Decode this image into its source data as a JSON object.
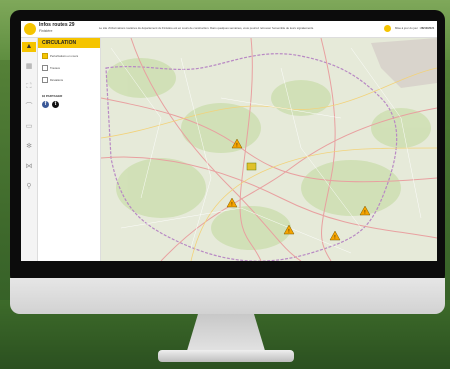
{
  "app": {
    "title": "Infos routes 29",
    "subtitle": "Finistère",
    "notice": "Le site d'informations routières du département du Finistère est en cours de construction. Dans quelques semaines, vous pourrez retrouver l'ensemble de leurs signalements.",
    "date_label": "Mise à jour du jour :",
    "date_value": "28/10/2021"
  },
  "rail": {
    "icons": [
      "circulation-icon",
      "calendar-icon",
      "road-icon",
      "bridge-icon",
      "truck-icon",
      "snow-icon",
      "share-rail-icon",
      "search-rail-icon"
    ]
  },
  "panel": {
    "title": "CIRCULATION",
    "options": [
      {
        "label": "Perturbations en cours",
        "checked": true
      },
      {
        "label": "Travaux",
        "checked": false
      },
      {
        "label": "Déviations",
        "checked": false
      }
    ],
    "share_label": "PARTAGER",
    "social": [
      {
        "name": "facebook",
        "glyph": "f",
        "color": "#3b5998"
      },
      {
        "name": "twitter",
        "glyph": "t",
        "color": "#111111"
      }
    ]
  },
  "colors": {
    "accent": "#f5c400",
    "warning": "#f5a300"
  },
  "map": {
    "markers": [
      {
        "type": "warning"
      },
      {
        "type": "warning"
      },
      {
        "type": "warning"
      },
      {
        "type": "warning"
      },
      {
        "type": "warning"
      },
      {
        "type": "works"
      }
    ]
  }
}
